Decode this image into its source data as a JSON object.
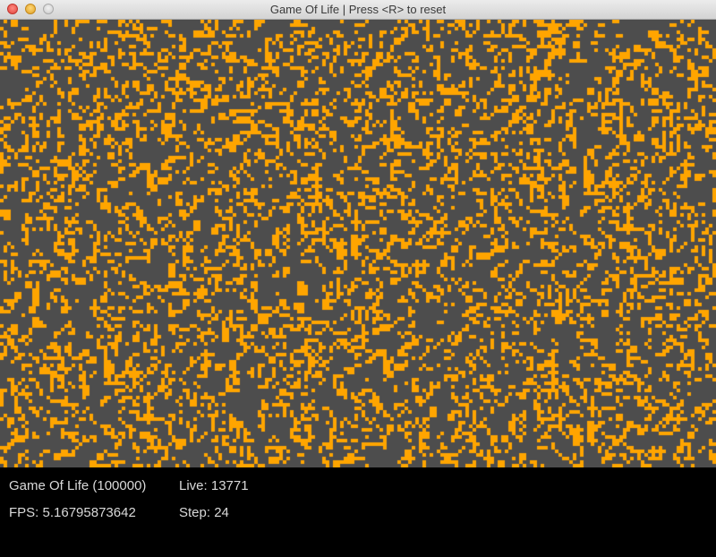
{
  "window": {
    "title": "Game Of Life  |  Press <R> to reset"
  },
  "board": {
    "dead_color": "#4d4d4d",
    "live_color": "#ffa500",
    "live_fraction": 0.22
  },
  "hud": {
    "name": "Game Of Life (100000)",
    "live": "Live: 13771",
    "fps": "FPS: 5.16795873642",
    "step": "Step: 24"
  }
}
